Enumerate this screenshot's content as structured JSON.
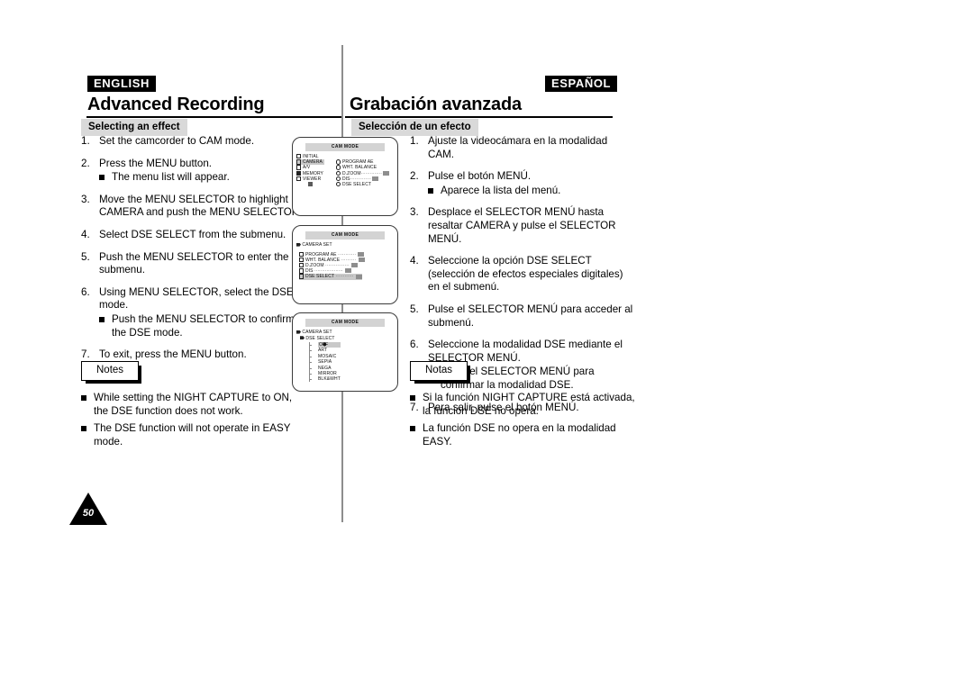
{
  "page": {
    "number": "50"
  },
  "left": {
    "lang_tag": "ENGLISH",
    "chapter_title": "Advanced Recording",
    "section_badge": "Selecting an effect",
    "steps": [
      {
        "num": "1.",
        "text": "Set the camcorder to CAM mode.",
        "sub": []
      },
      {
        "num": "2.",
        "text": "Press the MENU button.",
        "sub": [
          "The menu list will appear."
        ]
      },
      {
        "num": "3.",
        "text": "Move the MENU SELECTOR to highlight CAMERA and push the MENU SELECTOR.",
        "sub": []
      },
      {
        "num": "4.",
        "text": "Select DSE SELECT from the submenu.",
        "sub": []
      },
      {
        "num": "5.",
        "text": "Push the MENU SELECTOR to enter the submenu.",
        "sub": []
      },
      {
        "num": "6.",
        "text": "Using MENU SELECTOR, select the DSE mode.",
        "sub": [
          "Push the MENU SELECTOR to confirm the DSE mode."
        ]
      },
      {
        "num": "7.",
        "text": "To exit, press the MENU button.",
        "sub": []
      }
    ],
    "notes_label": "Notes",
    "notes": [
      "While setting the NIGHT CAPTURE to ON, the DSE function does not work.",
      "The DSE function will not operate in EASY mode."
    ]
  },
  "right": {
    "lang_tag": "ESPAÑOL",
    "chapter_title": "Grabación avanzada",
    "section_badge": "Selección de un efecto",
    "steps": [
      {
        "num": "1.",
        "text": "Ajuste la videocámara en la modalidad CAM.",
        "sub": []
      },
      {
        "num": "2.",
        "text": "Pulse el botón MENÚ.",
        "sub": [
          "Aparece la lista del menú."
        ]
      },
      {
        "num": "3.",
        "text": "Desplace el SELECTOR MENÚ hasta resaltar CAMERA y pulse el SELECTOR MENÚ.",
        "sub": []
      },
      {
        "num": "4.",
        "text": "Seleccione la opción DSE SELECT (selección de efectos especiales digitales) en el submenú.",
        "sub": []
      },
      {
        "num": "5.",
        "text": "Pulse el SELECTOR MENÚ para acceder al submenú.",
        "sub": []
      },
      {
        "num": "6.",
        "text": "Seleccione la modalidad DSE mediante el SELECTOR MENÚ.",
        "sub": [
          "Pulse el SELECTOR MENÚ para confirmar la modalidad DSE."
        ]
      },
      {
        "num": "7.",
        "text": "Para salir, pulse el botón MENÚ.",
        "sub": []
      }
    ],
    "notes_label": "Notas",
    "notes": [
      "Si la función NIGHT CAPTURE está activada, la función DSE no opera.",
      "La función DSE no opera en la modalidad EASY."
    ]
  },
  "lcd_screens": [
    {
      "title": "CAM MODE",
      "main_menu": [
        {
          "label": "INITIAL",
          "highlighted": false,
          "icon": "folder-icon"
        },
        {
          "label": "CAMERA",
          "highlighted": true,
          "icon": "folder-icon"
        },
        {
          "label": "A/V",
          "highlighted": false,
          "icon": "folder-icon"
        },
        {
          "label": "MEMORY",
          "highlighted": false,
          "icon": "folder-filled-icon"
        },
        {
          "label": "VIEWER",
          "highlighted": false,
          "icon": "folder-icon"
        }
      ],
      "sub_menu": [
        {
          "label": "PROGRAM AE",
          "value": "",
          "dots": false
        },
        {
          "label": "WHT. BALANCE",
          "value": "",
          "dots": false
        },
        {
          "label": "D.ZOOM",
          "value": "OFF",
          "dots": true
        },
        {
          "label": "DIS",
          "value": "OFF",
          "dots": true
        },
        {
          "label": "DSE SELECT",
          "value": "",
          "dots": false
        }
      ]
    },
    {
      "title": "CAM MODE",
      "breadcrumb": [
        "CAMERA SET"
      ],
      "items": [
        {
          "label": "PROGRAM AE",
          "value": "AUTO",
          "selected": false
        },
        {
          "label": "WHT. BALANCE",
          "value": "AUTO",
          "selected": false
        },
        {
          "label": "D.ZOOM",
          "value": "OFF",
          "selected": false
        },
        {
          "label": "DIS",
          "value": "OFF",
          "selected": false
        },
        {
          "label": "DSE SELECT",
          "value": "OFF",
          "selected": true
        }
      ]
    },
    {
      "title": "CAM MODE",
      "breadcrumb": [
        "CAMERA SET",
        "DSE SELECT"
      ],
      "options": [
        {
          "label": "OFF",
          "selected": true
        },
        {
          "label": "ART",
          "selected": false
        },
        {
          "label": "MOSAIC",
          "selected": false
        },
        {
          "label": "SEPIA",
          "selected": false
        },
        {
          "label": "NEGA",
          "selected": false
        },
        {
          "label": "MIRROR",
          "selected": false
        },
        {
          "label": "BLK&WHT",
          "selected": false
        }
      ]
    }
  ]
}
